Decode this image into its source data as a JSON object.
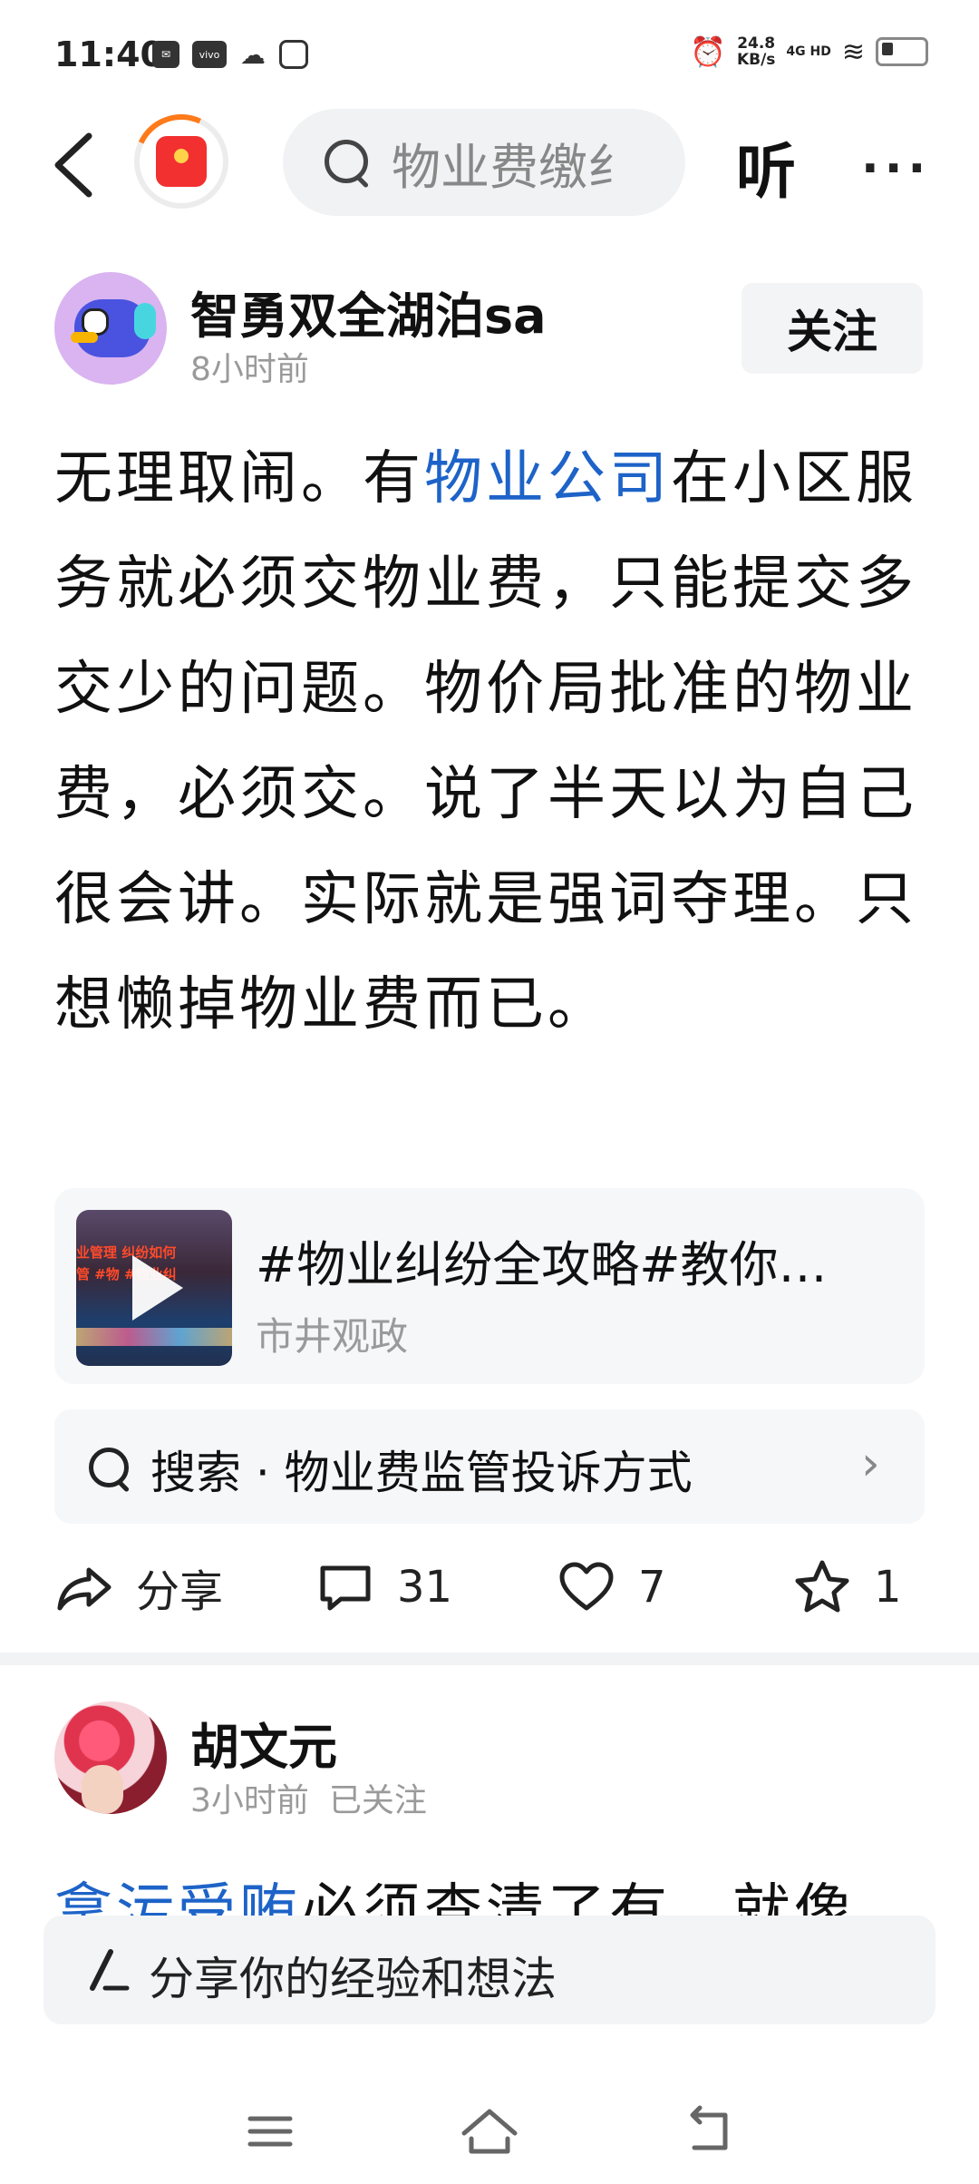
{
  "status_bar": {
    "time": "11:40",
    "speed_value": "24.8",
    "speed_unit": "KB/s",
    "network": "4G HD",
    "notification_icons": [
      "message-icon",
      "vivo-icon",
      "wechat-icon",
      "hand-icon"
    ]
  },
  "top_nav": {
    "search_placeholder": "物业费缴纟",
    "listen_label": "听",
    "more_label": "···"
  },
  "post1": {
    "author": "智勇双全湖泊sa",
    "time": "8小时前",
    "follow_label": "关注",
    "text_before_link": "无理取闹。有",
    "link_text": "物业公司",
    "text_after_link": "在小区服务就必须交物业费，只能提交多交少的问题。物价局批准的物业费，必须交。说了半天以为自己很会讲。实际就是强词夺理。只想懒掉物业费而已。",
    "video": {
      "title": "#物业纠纷全攻略#教你…",
      "source": "市井观政",
      "thumb_line1": "业管理 纠纷如何",
      "thumb_line2": "管 #物 #物业纠"
    },
    "related_search": {
      "label": "搜索 · 物业费监管投诉方式",
      "chevron": "›"
    },
    "actions": {
      "share": "分享",
      "comments": "31",
      "likes": "7",
      "favorites": "1"
    }
  },
  "post2": {
    "author": "胡文元",
    "time": "3小时前",
    "status": "已关注",
    "text_link": "拿污受贿",
    "text_rest": "必须查清了有，就像"
  },
  "comment_bar": {
    "placeholder": "分享你的经验和想法"
  },
  "colors": {
    "link": "#1d63c8",
    "secondary_text": "#9a9a9a",
    "card_bg": "#f6f7f9"
  }
}
